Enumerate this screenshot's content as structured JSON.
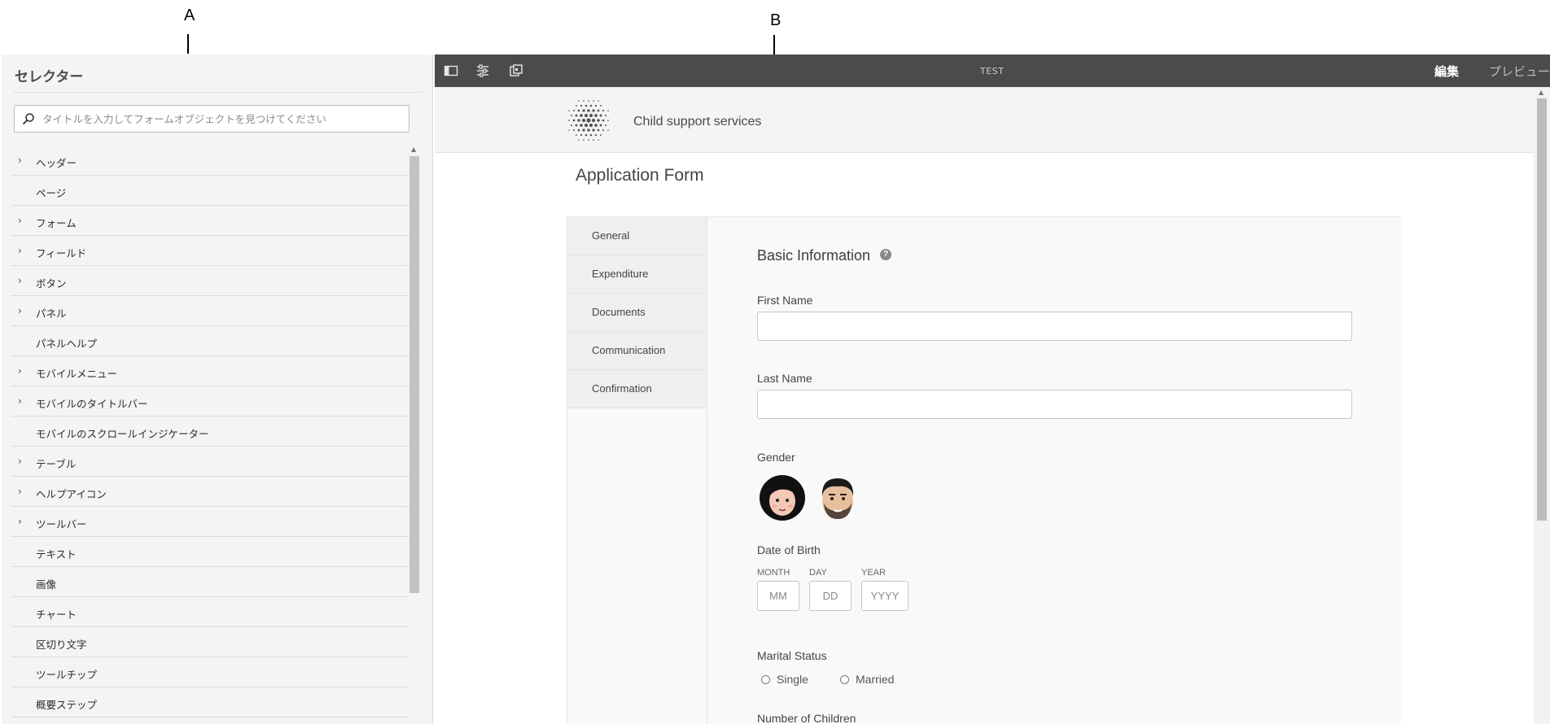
{
  "callouts": {
    "a": "A",
    "b": "B"
  },
  "selector_panel": {
    "title": "セレクター",
    "search_placeholder": "タイトルを入力してフォームオブジェクトを見つけてください",
    "items": [
      {
        "label": "ヘッダー",
        "expandable": true
      },
      {
        "label": "ページ",
        "expandable": false
      },
      {
        "label": "フォーム",
        "expandable": true
      },
      {
        "label": "フィールド",
        "expandable": true
      },
      {
        "label": "ボタン",
        "expandable": true
      },
      {
        "label": "パネル",
        "expandable": true
      },
      {
        "label": "パネルヘルプ",
        "expandable": false
      },
      {
        "label": "モバイルメニュー",
        "expandable": true
      },
      {
        "label": "モバイルのタイトルバー",
        "expandable": true
      },
      {
        "label": "モバイルのスクロールインジケーター",
        "expandable": false
      },
      {
        "label": "テーブル",
        "expandable": true
      },
      {
        "label": "ヘルプアイコン",
        "expandable": true
      },
      {
        "label": "ツールバー",
        "expandable": true
      },
      {
        "label": "テキスト",
        "expandable": false
      },
      {
        "label": "画像",
        "expandable": false
      },
      {
        "label": "チャート",
        "expandable": false
      },
      {
        "label": "区切り文字",
        "expandable": false
      },
      {
        "label": "ツールチップ",
        "expandable": false
      },
      {
        "label": "概要ステップ",
        "expandable": false
      }
    ],
    "chevron": "›"
  },
  "toolbar": {
    "icons": [
      "side-panel-icon",
      "properties-icon",
      "emulator-icon"
    ],
    "document_title": "TEST",
    "edit_label": "編集",
    "preview_label": "プレビュー"
  },
  "form": {
    "brand_name": "Child support services",
    "title": "Application Form",
    "tabs": [
      "General",
      "Expenditure",
      "Documents",
      "Communication",
      "Confirmation"
    ],
    "section_title": "Basic Information",
    "help_glyph": "?",
    "first_name_label": "First Name",
    "last_name_label": "Last Name",
    "gender_label": "Gender",
    "dob_label": "Date of Birth",
    "month_label": "MONTH",
    "day_label": "DAY",
    "year_label": "YEAR",
    "month_placeholder": "MM",
    "day_placeholder": "DD",
    "year_placeholder": "YYYY",
    "marital_label": "Marital Status",
    "marital_options": [
      "Single",
      "Married"
    ],
    "children_label": "Number of Children"
  }
}
